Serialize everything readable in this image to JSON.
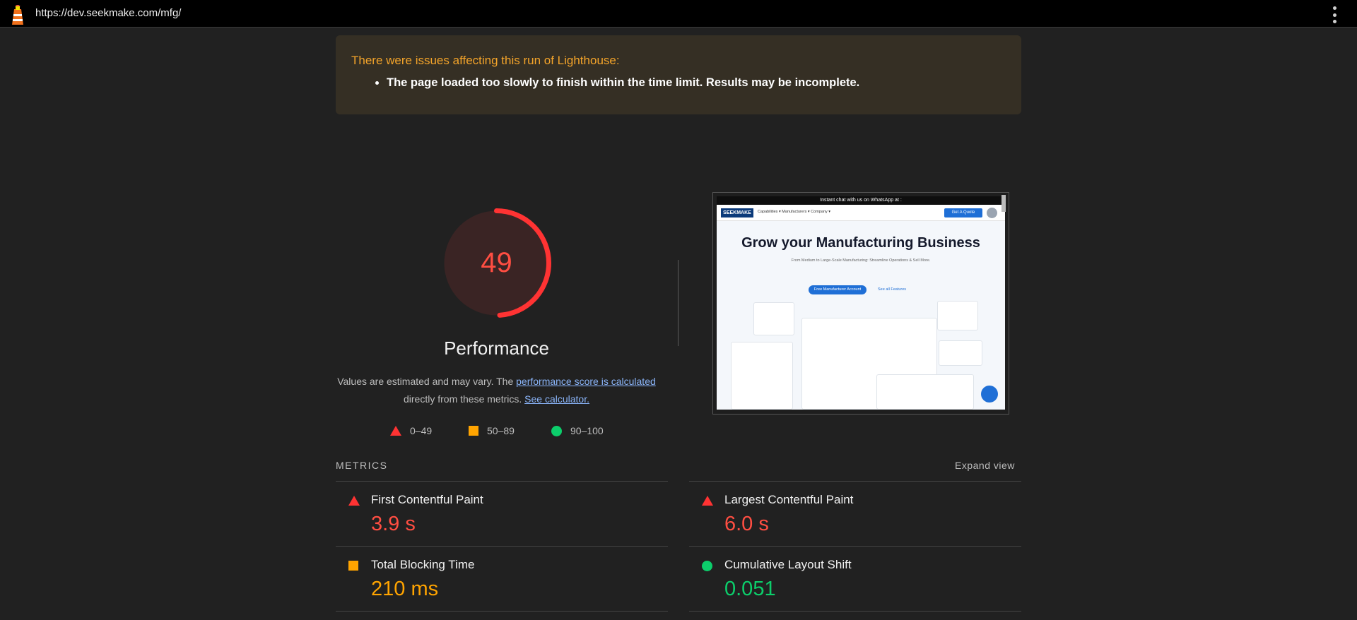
{
  "topbar": {
    "url": "https://dev.seekmake.com/mfg/"
  },
  "warning": {
    "title": "There were issues affecting this run of Lighthouse:",
    "items": [
      "The page loaded too slowly to finish within the time limit. Results may be incomplete."
    ]
  },
  "performance": {
    "score": "49",
    "score_fraction": 0.49,
    "title": "Performance",
    "desc_prefix": "Values are estimated and may vary. The ",
    "desc_link1": "performance score is calculated",
    "desc_middle": " directly from these metrics. ",
    "desc_link2": "See calculator."
  },
  "legend": [
    {
      "label": "0–49",
      "icon": "fail-triangle-icon",
      "color": "#ff3333"
    },
    {
      "label": "50–89",
      "icon": "average-square-icon",
      "color": "#ffa400"
    },
    {
      "label": "90–100",
      "icon": "pass-circle-icon",
      "color": "#0cce6b"
    }
  ],
  "screenshot": {
    "banner": "Instant chat with us on WhatsApp at :",
    "logo": "SEEKMAKE",
    "menu": "Capabilities ▾   Manufacturers ▾   Company ▾",
    "quote_button": "Get A Quote",
    "headline": "Grow your Manufacturing Business",
    "subline": "From Medium to Large-Scale Manufacturing: Streamline Operations & Sell More.",
    "cta": "Free Manufacturer Account",
    "link": "See all Features"
  },
  "metrics": {
    "heading": "METRICS",
    "expand_label": "Expand view",
    "items": [
      {
        "name": "First Contentful Paint",
        "value": "3.9 s",
        "status": "fail",
        "color": "#ff4e42"
      },
      {
        "name": "Largest Contentful Paint",
        "value": "6.0 s",
        "status": "fail",
        "color": "#ff4e42"
      },
      {
        "name": "Total Blocking Time",
        "value": "210 ms",
        "status": "average",
        "color": "#ffa400"
      },
      {
        "name": "Cumulative Layout Shift",
        "value": "0.051",
        "status": "pass",
        "color": "#0cce6b"
      }
    ]
  },
  "colors": {
    "fail": "#ff4e42",
    "average": "#ffa400",
    "pass": "#0cce6b",
    "warning_title": "#f4a42a"
  }
}
